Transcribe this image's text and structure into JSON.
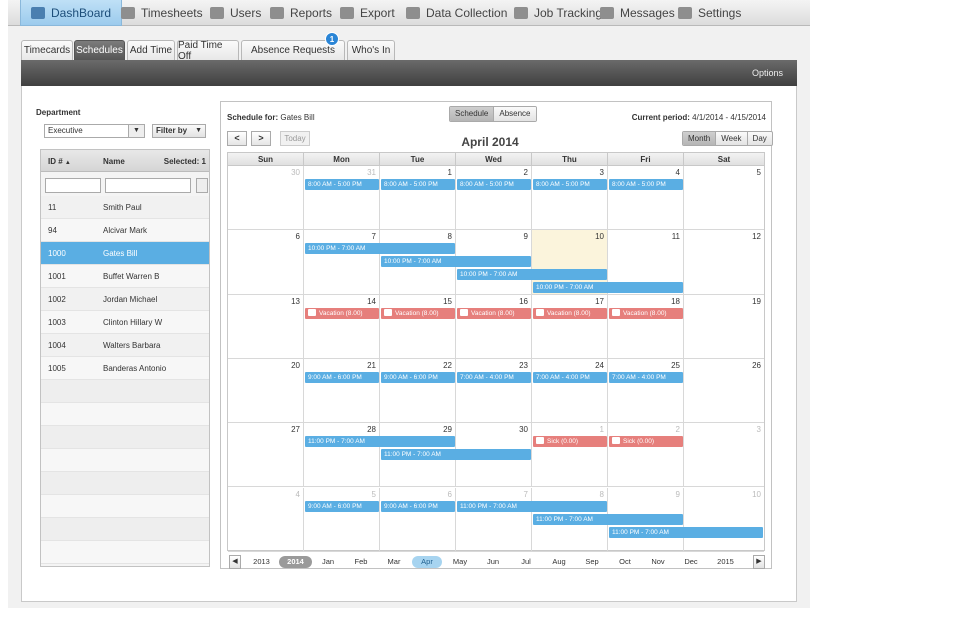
{
  "nav": [
    {
      "label": "DashBoard",
      "icon": "dashboard-icon",
      "active": true
    },
    {
      "label": "Timesheets",
      "icon": "timesheet-icon"
    },
    {
      "label": "Users",
      "icon": "user-icon"
    },
    {
      "label": "Reports",
      "icon": "reports-icon"
    },
    {
      "label": "Export",
      "icon": "export-icon"
    },
    {
      "label": "Data Collection",
      "icon": "data-collection-icon"
    },
    {
      "label": "Job Tracking",
      "icon": "job-tracking-icon"
    },
    {
      "label": "Messages",
      "icon": "messages-icon"
    },
    {
      "label": "Settings",
      "icon": "settings-icon"
    }
  ],
  "tabs": [
    {
      "label": "Timecards"
    },
    {
      "label": "Schedules",
      "active": true
    },
    {
      "label": "Add Time"
    },
    {
      "label": "Paid Time Off"
    },
    {
      "label": "Absence Requests",
      "badge": "1"
    },
    {
      "label": "Who's In"
    }
  ],
  "toolbar": {
    "options": "Options"
  },
  "department": {
    "label": "Department",
    "selected": "Executive",
    "filter_label": "Filter by"
  },
  "user_list": {
    "columns": {
      "id": "ID #",
      "name": "Name",
      "selected": "Selected: 1"
    },
    "rows": [
      {
        "id": "11",
        "name": "Smith Paul"
      },
      {
        "id": "94",
        "name": "Alcivar Mark"
      },
      {
        "id": "1000",
        "name": "Gates Bill",
        "selected": true
      },
      {
        "id": "1001",
        "name": "Buffet Warren B"
      },
      {
        "id": "1002",
        "name": "Jordan Michael"
      },
      {
        "id": "1003",
        "name": "Clinton Hillary W"
      },
      {
        "id": "1004",
        "name": "Walters Barbara"
      },
      {
        "id": "1005",
        "name": "Banderas Antonio"
      }
    ]
  },
  "calendar": {
    "schedule_for_label": "Schedule for:",
    "schedule_for_name": "Gates Bill",
    "view_toggle": [
      "Schedule",
      "Absence"
    ],
    "view_active": "Schedule",
    "period_label": "Current period:",
    "period_value": "4/1/2014 - 4/15/2014",
    "prev": "<",
    "next": ">",
    "today": "Today",
    "month_title": "April 2014",
    "range_buttons": [
      "Month",
      "Week",
      "Day"
    ],
    "range_active": "Month",
    "days_of_week": [
      "Sun",
      "Mon",
      "Tue",
      "Wed",
      "Thu",
      "Fri",
      "Sat"
    ],
    "weeks": [
      [
        {
          "d": "30",
          "o": true
        },
        {
          "d": "31",
          "o": true
        },
        {
          "d": "1"
        },
        {
          "d": "2"
        },
        {
          "d": "3"
        },
        {
          "d": "4"
        },
        {
          "d": "5"
        }
      ],
      [
        {
          "d": "6"
        },
        {
          "d": "7"
        },
        {
          "d": "8"
        },
        {
          "d": "9"
        },
        {
          "d": "10",
          "today": true
        },
        {
          "d": "11"
        },
        {
          "d": "12"
        }
      ],
      [
        {
          "d": "13"
        },
        {
          "d": "14"
        },
        {
          "d": "15"
        },
        {
          "d": "16"
        },
        {
          "d": "17"
        },
        {
          "d": "18"
        },
        {
          "d": "19"
        }
      ],
      [
        {
          "d": "20"
        },
        {
          "d": "21"
        },
        {
          "d": "22"
        },
        {
          "d": "23"
        },
        {
          "d": "24"
        },
        {
          "d": "25"
        },
        {
          "d": "26"
        }
      ],
      [
        {
          "d": "27"
        },
        {
          "d": "28"
        },
        {
          "d": "29"
        },
        {
          "d": "30"
        },
        {
          "d": "1",
          "o": true
        },
        {
          "d": "2",
          "o": true
        },
        {
          "d": "3",
          "o": true
        }
      ],
      [
        {
          "d": "4",
          "o": true
        },
        {
          "d": "5",
          "o": true
        },
        {
          "d": "6",
          "o": true
        },
        {
          "d": "7",
          "o": true
        },
        {
          "d": "8",
          "o": true
        },
        {
          "d": "9",
          "o": true
        },
        {
          "d": "10",
          "o": true
        }
      ]
    ],
    "events": [
      {
        "week": 0,
        "day": 1,
        "span": 1,
        "lane": 0,
        "type": "work",
        "label": "8:00 AM - 5:00 PM"
      },
      {
        "week": 0,
        "day": 2,
        "span": 1,
        "lane": 0,
        "type": "work",
        "label": "8:00 AM - 5:00 PM"
      },
      {
        "week": 0,
        "day": 3,
        "span": 1,
        "lane": 0,
        "type": "work",
        "label": "8:00 AM - 5:00 PM"
      },
      {
        "week": 0,
        "day": 4,
        "span": 1,
        "lane": 0,
        "type": "work",
        "label": "8:00 AM - 5:00 PM"
      },
      {
        "week": 0,
        "day": 5,
        "span": 1,
        "lane": 0,
        "type": "work",
        "label": "8:00 AM - 5:00 PM"
      },
      {
        "week": 1,
        "day": 1,
        "span": 2,
        "lane": 0,
        "type": "work",
        "label": "10:00 PM - 7:00 AM"
      },
      {
        "week": 1,
        "day": 2,
        "span": 2,
        "lane": 1,
        "type": "work",
        "label": "10:00 PM - 7:00 AM"
      },
      {
        "week": 1,
        "day": 3,
        "span": 2,
        "lane": 2,
        "type": "work",
        "label": "10:00 PM - 7:00 AM"
      },
      {
        "week": 1,
        "day": 4,
        "span": 2,
        "lane": 3,
        "type": "work",
        "label": "10:00 PM - 7:00 AM"
      },
      {
        "week": 2,
        "day": 1,
        "span": 1,
        "lane": 0,
        "type": "vac",
        "icon": "vacation-icon",
        "label": "Vacation (8.00)"
      },
      {
        "week": 2,
        "day": 2,
        "span": 1,
        "lane": 0,
        "type": "vac",
        "icon": "vacation-icon",
        "label": "Vacation (8.00)"
      },
      {
        "week": 2,
        "day": 3,
        "span": 1,
        "lane": 0,
        "type": "vac",
        "icon": "vacation-icon",
        "label": "Vacation (8.00)"
      },
      {
        "week": 2,
        "day": 4,
        "span": 1,
        "lane": 0,
        "type": "vac",
        "icon": "vacation-icon",
        "label": "Vacation (8.00)"
      },
      {
        "week": 2,
        "day": 5,
        "span": 1,
        "lane": 0,
        "type": "vac",
        "icon": "vacation-icon",
        "label": "Vacation (8.00)"
      },
      {
        "week": 3,
        "day": 1,
        "span": 1,
        "lane": 0,
        "type": "work",
        "label": "9:00 AM - 6:00 PM"
      },
      {
        "week": 3,
        "day": 2,
        "span": 1,
        "lane": 0,
        "type": "work",
        "label": "9:00 AM - 6:00 PM"
      },
      {
        "week": 3,
        "day": 3,
        "span": 1,
        "lane": 0,
        "type": "work",
        "label": "7:00 AM - 4:00 PM"
      },
      {
        "week": 3,
        "day": 4,
        "span": 1,
        "lane": 0,
        "type": "work",
        "label": "7:00 AM - 4:00 PM"
      },
      {
        "week": 3,
        "day": 5,
        "span": 1,
        "lane": 0,
        "type": "work",
        "label": "7:00 AM - 4:00 PM"
      },
      {
        "week": 4,
        "day": 1,
        "span": 2,
        "lane": 0,
        "type": "work",
        "label": "11:00 PM - 7:00 AM"
      },
      {
        "week": 4,
        "day": 2,
        "span": 2,
        "lane": 1,
        "type": "work",
        "label": "11:00 PM - 7:00 AM"
      },
      {
        "week": 4,
        "day": 4,
        "span": 1,
        "lane": 0,
        "type": "vac",
        "icon": "sick-icon",
        "label": "Sick (0.00)"
      },
      {
        "week": 4,
        "day": 5,
        "span": 1,
        "lane": 0,
        "type": "vac",
        "icon": "sick-icon",
        "label": "Sick (0.00)"
      },
      {
        "week": 5,
        "day": 1,
        "span": 1,
        "lane": 0,
        "type": "work",
        "label": "9:00 AM - 6:00 PM"
      },
      {
        "week": 5,
        "day": 2,
        "span": 1,
        "lane": 0,
        "type": "work",
        "label": "9:00 AM - 6:00 PM"
      },
      {
        "week": 5,
        "day": 3,
        "span": 2,
        "lane": 0,
        "type": "work",
        "label": "11:00 PM - 7:00 AM"
      },
      {
        "week": 5,
        "day": 4,
        "span": 2,
        "lane": 1,
        "type": "work",
        "label": "11:00 PM - 7:00 AM"
      },
      {
        "week": 5,
        "day": 5,
        "span": 2,
        "lane": 2,
        "type": "work",
        "label": "11:00 PM - 7:00 AM"
      }
    ]
  },
  "timeline": {
    "items": [
      "2013",
      "2014",
      "Jan",
      "Feb",
      "Mar",
      "Apr",
      "May",
      "Jun",
      "Jul",
      "Aug",
      "Sep",
      "Oct",
      "Nov",
      "Dec",
      "2015"
    ],
    "selected_year": "2014",
    "selected_month": "Apr"
  }
}
